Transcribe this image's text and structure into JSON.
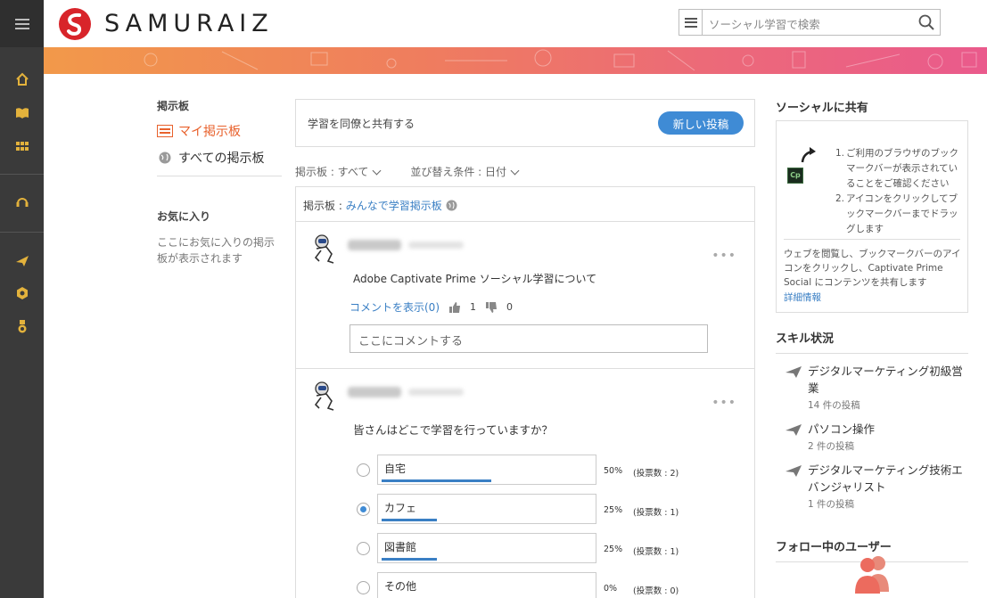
{
  "header": {
    "logo_text": "SAMURAIZ",
    "search_placeholder": "ソーシャル学習で検索"
  },
  "colors": {
    "accent": "#e8612c",
    "link": "#3a7fc4",
    "primary_button": "#3f8bd5",
    "sidebar": "#3a3a3a",
    "sidebar_icon": "#e3b23c"
  },
  "sidebar_icons": [
    "home-icon",
    "book-icon",
    "grid-icon",
    "support-icon",
    "send-icon",
    "badge-icon",
    "medal-icon"
  ],
  "boards": {
    "heading": "掲示板",
    "my_board": "マイ掲示板",
    "all_boards": "すべての掲示板",
    "favorites_heading": "お気に入り",
    "favorites_text": "ここにお気に入りの掲示板が表示されます"
  },
  "main": {
    "share_prompt": "学習を同僚と共有する",
    "new_post_button": "新しい投稿",
    "filter_board": "掲示板 : すべて",
    "filter_sort": "並び替え条件 : 日付",
    "board_label": "掲示板 : ",
    "board_name": "みんなで学習掲示板"
  },
  "posts": [
    {
      "text": "Adobe Captivate Prime ソーシャル学習について",
      "show_comments": "コメントを表示(0)",
      "likes": "1",
      "dislikes": "0",
      "comment_placeholder": "ここにコメントする"
    },
    {
      "question": "皆さんはどこで学習を行っていますか？",
      "options": [
        {
          "label": "自宅",
          "percent": "50%",
          "votes": "(投票数 : 2)",
          "fraction": 0.5,
          "selected": false
        },
        {
          "label": "カフェ",
          "percent": "25%",
          "votes": "(投票数 : 1)",
          "fraction": 0.25,
          "selected": true
        },
        {
          "label": "図書館",
          "percent": "25%",
          "votes": "(投票数 : 1)",
          "fraction": 0.25,
          "selected": false
        },
        {
          "label": "その他",
          "percent": "0%",
          "votes": "(投票数 : 0)",
          "fraction": 0,
          "selected": false
        }
      ]
    }
  ],
  "right": {
    "social_heading": "ソーシャルに共有",
    "cp_label": "Cp",
    "step1": "ご利用のブラウザのブックマークバーが表示されていることをご確認ください",
    "step2": "アイコンをクリックしてブックマークバーまでドラッグします",
    "step1_num": "1.",
    "step2_num": "2.",
    "web_text": "ウェブを閲覧し、ブックマークバーのアイコンをクリックし、Captivate Prime Social にコンテンツを共有します",
    "detail_link": "詳細情報",
    "skills_heading": "スキル状況",
    "skills": [
      {
        "name": "デジタルマーケティング初級営業",
        "count": "14 件の投稿"
      },
      {
        "name": "パソコン操作",
        "count": "2 件の投稿"
      },
      {
        "name": "デジタルマーケティング技術エバンジャリスト",
        "count": "1 件の投稿"
      }
    ],
    "following_heading": "フォロー中のユーザー"
  }
}
